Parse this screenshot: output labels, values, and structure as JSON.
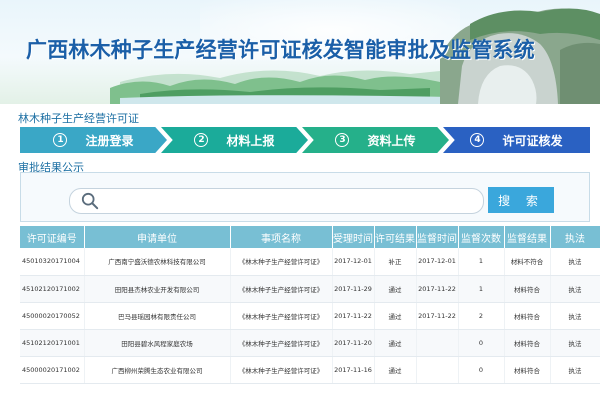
{
  "header": {
    "title": "广西林木种子生产经营许可证核发智能审批及监管系统"
  },
  "section": {
    "title": "林木种子生产经营许可证"
  },
  "steps": [
    {
      "num": "1",
      "label": "注册登录"
    },
    {
      "num": "2",
      "label": "材料上报"
    },
    {
      "num": "3",
      "label": "资料上传"
    },
    {
      "num": "4",
      "label": "许可证核发"
    }
  ],
  "results": {
    "title": "审批结果公示",
    "search_value": "",
    "search_button": "搜 索",
    "columns": [
      "许可证编号",
      "申请单位",
      "事项名称",
      "受理时间",
      "许可结果",
      "监督时间",
      "监督次数",
      "监督结果",
      "执法"
    ],
    "rows": [
      [
        "45010320171004",
        "广西南宁盛沃德农林科技有限公司",
        "《林木种子生产经营许可证》",
        "2017-12-01",
        "补正",
        "2017-12-01",
        "1",
        "材料不符合",
        "执法"
      ],
      [
        "45102120171002",
        "田阳县杰林农业开发有限公司",
        "《林木种子生产经营许可证》",
        "2017-11-29",
        "通过",
        "2017-11-22",
        "1",
        "材料符合",
        "执法"
      ],
      [
        "45000020170052",
        "巴马县瑶园林有限责任公司",
        "《林木种子生产经营许可证》",
        "2017-11-22",
        "通过",
        "2017-11-22",
        "2",
        "材料符合",
        "执法"
      ],
      [
        "45102120171001",
        "田阳县碧水风程家庭农场",
        "《林木种子生产经营许可证》",
        "2017-11-20",
        "通过",
        "",
        "0",
        "材料符合",
        "执法"
      ],
      [
        "45000020171002",
        "广西柳州荣腾生态农业有限公司",
        "《林木种子生产经营许可证》",
        "2017-11-16",
        "通过",
        "",
        "0",
        "材料符合",
        "执法"
      ]
    ]
  }
}
